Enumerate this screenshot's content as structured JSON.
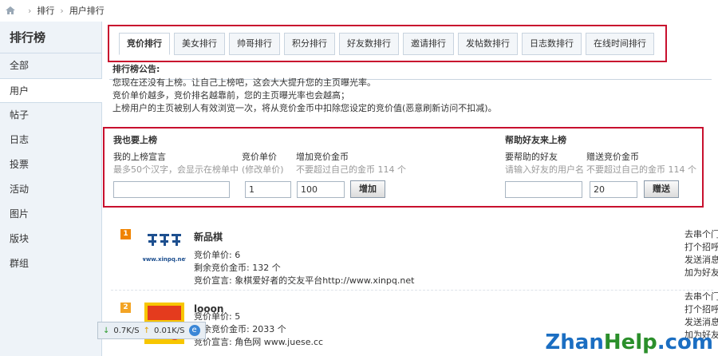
{
  "breadcrumb": {
    "items": [
      "排行",
      "用户排行"
    ]
  },
  "sidebar": {
    "title": "排行榜",
    "items": [
      "全部",
      "用户",
      "帖子",
      "日志",
      "投票",
      "活动",
      "图片",
      "版块",
      "群组"
    ],
    "active_index": 1
  },
  "tabs": [
    "竞价排行",
    "美女排行",
    "帅哥排行",
    "积分排行",
    "好友数排行",
    "邀请排行",
    "发帖数排行",
    "日志数排行",
    "在线时间排行"
  ],
  "active_tab": 0,
  "notice": {
    "heading": "排行榜公告:",
    "lines": [
      "您现在还没有上榜。让自己上榜吧，这会大大提升您的主页曝光率。",
      "竞价单价越多，竞价排名越靠前，您的主页曝光率也会越高；",
      "上榜用户的主页被别人有效浏览一次，将从竞价金币中扣除您设定的竞价值(恶意刷新访问不扣减)。"
    ]
  },
  "self_rank": {
    "heading": "我也要上榜",
    "declaration_label": "我的上榜宣言",
    "declaration_hint": "最多50个汉字，会显示在榜单中",
    "declaration_value": "",
    "price_label": "竞价单价",
    "price_hint": "(修改单价)",
    "price_value": "1",
    "gold_label": "增加竞价金币",
    "gold_hint": "不要超过自己的金币 114 个",
    "gold_value": "100",
    "submit_label": "增加"
  },
  "friend_rank": {
    "heading": "帮助好友来上榜",
    "friend_label": "要帮助的好友",
    "friend_hint": "请输入好友的用户名",
    "friend_value": "",
    "gold_label": "赠送竞价金币",
    "gold_hint": "不要超过自己的金币 114 个",
    "gold_value": "20",
    "submit_label": "赠送"
  },
  "ranks": [
    {
      "rank": "1",
      "name": "新品棋",
      "avatar_text": "www.xinpq.net",
      "price": "竞价单价: 6",
      "remaining": "剩余竞价金币: 132 个",
      "declaration": "竞价宣言: 象棋爱好者的交友平台http://www.xinpq.net",
      "actions": [
        "去串个门",
        "打个招呼",
        "发送消息",
        "加为好友"
      ]
    },
    {
      "rank": "2",
      "name": "looon",
      "avatar_text": "",
      "price": "竞价单价: 5",
      "remaining": "剩余竞价金币: 2033 个",
      "declaration": "竞价宣言: 角色网 www.juese.cc",
      "actions": [
        "去串个门",
        "打个招呼",
        "发送消息",
        "加为好友"
      ]
    }
  ],
  "netspeed": {
    "down": "0.7K/S",
    "up": "0.01K/S"
  },
  "watermark": {
    "part1": "Zhan",
    "part2": "Help",
    "part3": ".com"
  },
  "colors": {
    "highlight_border": "#c8102e",
    "sidebar_bg": "#eef3f8",
    "rank1": "#f08300",
    "rank2": "#f3a425"
  }
}
